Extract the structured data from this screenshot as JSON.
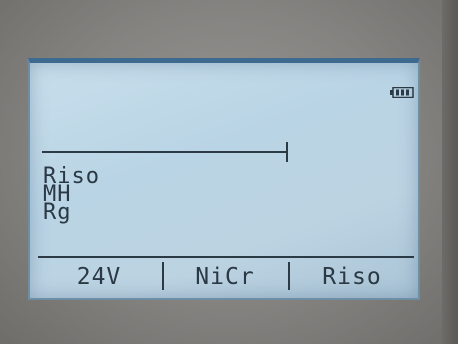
{
  "display": {
    "battery_icon": "battery-icon",
    "info_lines": [
      "Riso",
      "MH",
      "Rg"
    ]
  },
  "softkeys": [
    {
      "label": "24V"
    },
    {
      "label": "NiCr"
    },
    {
      "label": "Riso"
    }
  ],
  "colors": {
    "lcd_background": "#bcd6e6",
    "lcd_text": "#2a3944",
    "bezel": "#858380"
  }
}
